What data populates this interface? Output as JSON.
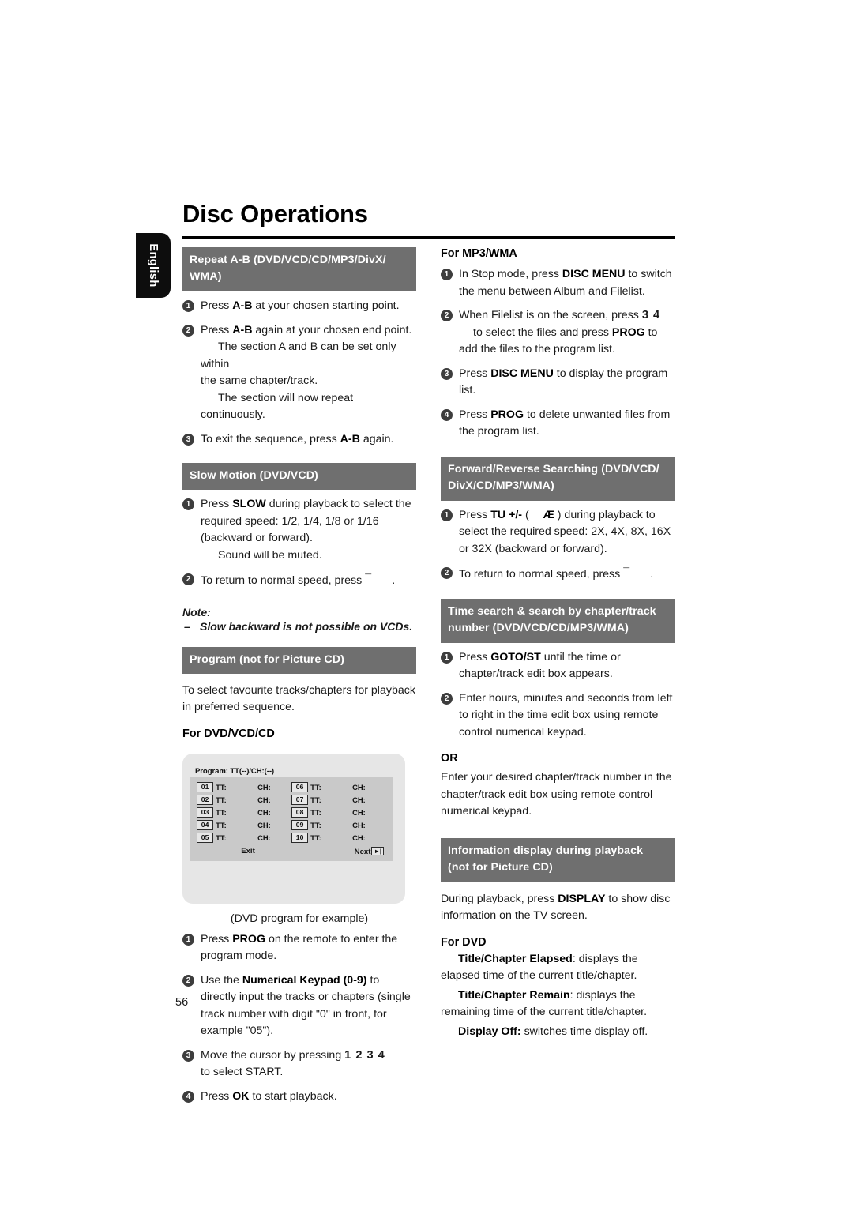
{
  "page": {
    "title": "Disc Operations",
    "side_tab": "English",
    "page_number": "56"
  },
  "left_column": {
    "repeat_ab": {
      "heading": "Repeat A-B (DVD/VCD/CD/MP3/DivX/ WMA)",
      "steps": [
        {
          "num": "1",
          "text_before": "Press ",
          "bold": "A-B",
          "text_after": " at your chosen starting point."
        },
        {
          "num": "2",
          "text_before": "Press ",
          "bold": "A-B",
          "text_after": " again at your chosen end point.",
          "sub1": "The section A and B can be set only within",
          "sub2": "the same chapter/track.",
          "sub3": "The section will now repeat continuously."
        },
        {
          "num": "3",
          "text_before": "To exit the sequence, press ",
          "bold": "A-B",
          "text_after": " again."
        }
      ]
    },
    "slow_motion": {
      "heading": "Slow Motion (DVD/VCD)",
      "steps": [
        {
          "num": "1",
          "text_before": "Press ",
          "bold": "SLOW",
          "text_after": " during playback to select the required speed: 1/2, 1/4, 1/8 or 1/16 (backward or forward).",
          "sub1": "Sound will be muted."
        },
        {
          "num": "2",
          "text_before": "To return to normal speed, press ",
          "glyph": "¯",
          "text_after": "."
        }
      ],
      "note_label": "Note:",
      "note_dash": "–",
      "note_text": "Slow backward is not possible on VCDs."
    },
    "program": {
      "heading": "Program (not for Picture CD)",
      "intro": "To select favourite tracks/chapters for playback in preferred sequence.",
      "sub_head": "For DVD/VCD/CD",
      "figure": {
        "title": "Program: TT(--)/CH:(--)",
        "rows": [
          {
            "n1": "01",
            "tt1": "TT:",
            "ch1": "CH:",
            "n2": "06",
            "tt2": "TT:",
            "ch2": "CH:"
          },
          {
            "n1": "02",
            "tt1": "TT:",
            "ch1": "CH:",
            "n2": "07",
            "tt2": "TT:",
            "ch2": "CH:"
          },
          {
            "n1": "03",
            "tt1": "TT:",
            "ch1": "CH:",
            "n2": "08",
            "tt2": "TT:",
            "ch2": "CH:"
          },
          {
            "n1": "04",
            "tt1": "TT:",
            "ch1": "CH:",
            "n2": "09",
            "tt2": "TT:",
            "ch2": "CH:"
          },
          {
            "n1": "05",
            "tt1": "TT:",
            "ch1": "CH:",
            "n2": "10",
            "tt2": "TT:",
            "ch2": "CH:"
          }
        ],
        "exit_label": "Exit",
        "next_label": "Next",
        "next_key": "►|"
      },
      "caption": "(DVD program for example)",
      "steps": [
        {
          "num": "1",
          "text_before": "Press ",
          "bold": "PROG",
          "text_after": " on the remote to enter the program mode."
        },
        {
          "num": "2",
          "text_before": "Use the ",
          "bold": "Numerical Keypad (0-9)",
          "text_after": " to directly input the tracks or chapters (single track number with digit \"0\" in front, for example \"05\")."
        },
        {
          "num": "3",
          "text_before": "Move the cursor by pressing ",
          "glyph": "1 2 3 4",
          "text_after": "to select START."
        },
        {
          "num": "4",
          "text_before": "Press ",
          "bold": "OK",
          "text_after": " to start playback."
        }
      ]
    }
  },
  "right_column": {
    "mp3_wma": {
      "sub_head": "For MP3/WMA",
      "steps": [
        {
          "num": "1",
          "text_before": "In Stop mode, press ",
          "bold": "DISC MENU",
          "text_after": " to switch the menu between Album and Filelist."
        },
        {
          "num": "2",
          "text_before": "When Filelist is on the screen, press ",
          "glyph": "3 4",
          "mid": "to select the files and press ",
          "bold": "PROG",
          "text_after": " to add the files to the program list."
        },
        {
          "num": "3",
          "text_before": "Press ",
          "bold": "DISC MENU",
          "text_after": " to display the program list."
        },
        {
          "num": "4",
          "text_before": "Press ",
          "bold": "PROG",
          "text_after": " to delete unwanted files from the program list."
        }
      ]
    },
    "searching": {
      "heading": "Forward/Reverse Searching (DVD/VCD/ DivX/CD/MP3/WMA)",
      "steps": [
        {
          "num": "1",
          "text_before": "Press ",
          "bold": "TU +/-",
          "mid": " ( ",
          "glyph": "Æ",
          "text_after": " ) during playback to select the required speed: 2X, 4X, 8X, 16X or 32X (backward or forward)."
        },
        {
          "num": "2",
          "text_before": "To return to normal speed, press ",
          "glyph": "¯",
          "text_after": "."
        }
      ]
    },
    "time_search": {
      "heading": "Time search & search by chapter/track number (DVD/VCD/CD/MP3/WMA)",
      "steps": [
        {
          "num": "1",
          "text_before": "Press ",
          "bold": "GOTO/ST",
          "text_after": " until the time or chapter/track edit box appears."
        },
        {
          "num": "2",
          "text_before": "Enter hours, minutes and seconds from left to right in the time edit box using remote control numerical keypad."
        }
      ],
      "or_label": "OR",
      "or_text": "Enter your desired chapter/track number in the chapter/track edit box using remote control numerical keypad."
    },
    "info_display": {
      "heading": "Information display during playback (not for Picture CD)",
      "intro_before": "During playback, press ",
      "intro_bold": "DISPLAY",
      "intro_after": " to show disc information on the TV screen.",
      "sub_head": "For DVD",
      "items": [
        {
          "bold": "Title/Chapter Elapsed",
          "text": ": displays the elapsed time of the current title/chapter."
        },
        {
          "bold": "Title/Chapter Remain",
          "text": ": displays the remaining time of the current title/chapter."
        },
        {
          "bold": "Display Off:",
          "text": " switches time display off."
        }
      ]
    }
  }
}
